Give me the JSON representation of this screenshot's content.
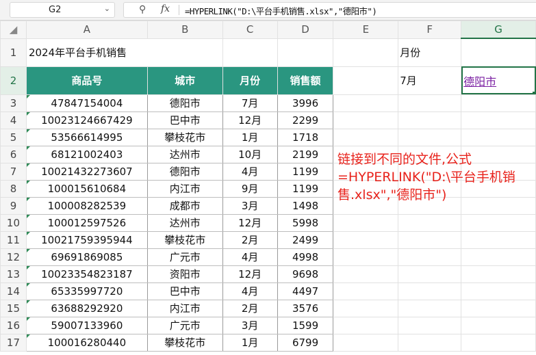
{
  "formula_bar": {
    "name_box": "G2",
    "fx_label": "fx",
    "formula": "=HYPERLINK(\"D:\\平台手机销售.xlsx\",\"德阳市\")"
  },
  "columns": [
    "A",
    "B",
    "C",
    "D",
    "E",
    "F",
    "G"
  ],
  "selected_column": "G",
  "selected_row": "2",
  "rows": {
    "title": "2024年平台手机销售",
    "month_label": "月份",
    "month_value": "7月",
    "link_text": "德阳市",
    "headers": [
      "商品号",
      "城市",
      "月份",
      "销售额"
    ],
    "data": [
      {
        "row": "3",
        "id": "47847154004",
        "city": "德阳市",
        "month": "7月",
        "sales": "3996"
      },
      {
        "row": "4",
        "id": "10023124667429",
        "city": "巴中市",
        "month": "12月",
        "sales": "2299"
      },
      {
        "row": "5",
        "id": "53566614995",
        "city": "攀枝花市",
        "month": "1月",
        "sales": "1718"
      },
      {
        "row": "6",
        "id": "68121002403",
        "city": "达州市",
        "month": "10月",
        "sales": "2199"
      },
      {
        "row": "7",
        "id": "10021432273607",
        "city": "德阳市",
        "month": "4月",
        "sales": "1199"
      },
      {
        "row": "8",
        "id": "100015610684",
        "city": "内江市",
        "month": "9月",
        "sales": "1199"
      },
      {
        "row": "9",
        "id": "100008282539",
        "city": "成都市",
        "month": "3月",
        "sales": "1498"
      },
      {
        "row": "10",
        "id": "100012597526",
        "city": "达州市",
        "month": "12月",
        "sales": "5998"
      },
      {
        "row": "11",
        "id": "10021759395944",
        "city": "攀枝花市",
        "month": "2月",
        "sales": "2499"
      },
      {
        "row": "12",
        "id": "69691869085",
        "city": "广元市",
        "month": "4月",
        "sales": "4998"
      },
      {
        "row": "13",
        "id": "10023354823187",
        "city": "资阳市",
        "month": "12月",
        "sales": "9698"
      },
      {
        "row": "14",
        "id": "65335997720",
        "city": "巴中市",
        "month": "4月",
        "sales": "4497"
      },
      {
        "row": "15",
        "id": "63688292920",
        "city": "内江市",
        "month": "2月",
        "sales": "3576"
      },
      {
        "row": "16",
        "id": "59007133960",
        "city": "广元市",
        "month": "3月",
        "sales": "1599"
      },
      {
        "row": "17",
        "id": "100016280440",
        "city": "攀枝花市",
        "month": "1月",
        "sales": "6799"
      }
    ]
  },
  "annotation": {
    "line1": "链接到不同的文件,公式",
    "line2": "=HYPERLINK(\"D:\\平台手机销",
    "line3": "售.xlsx\",\"德阳市\")"
  },
  "colors": {
    "header_fill": "#2a9680",
    "selection": "#217346",
    "annotation_text": "#e8231c",
    "link_text": "#7a1fa2"
  }
}
